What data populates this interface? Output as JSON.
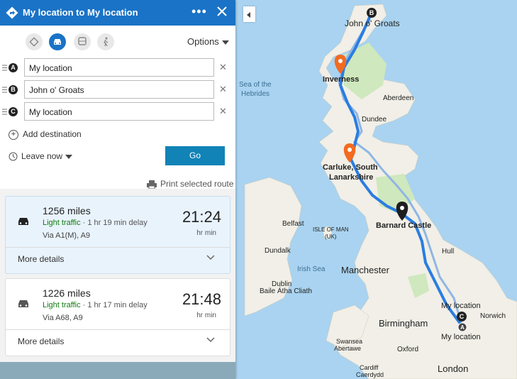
{
  "header": {
    "title": "My location to My location",
    "more_label": "•••"
  },
  "modes": [
    {
      "name": "directions-mode",
      "active": false
    },
    {
      "name": "driving-mode",
      "active": true
    },
    {
      "name": "transit-mode",
      "active": false
    },
    {
      "name": "walking-mode",
      "active": false
    }
  ],
  "options_label": "Options",
  "waypoints": [
    {
      "badge": "A",
      "value": "My location"
    },
    {
      "badge": "B",
      "value": "John o' Groats"
    },
    {
      "badge": "C",
      "value": "My location"
    }
  ],
  "add_destination": "Add destination",
  "leave_now": "Leave now",
  "go_label": "Go",
  "print_label": "Print selected route",
  "routes": [
    {
      "distance": "1256 miles",
      "traffic": "Light traffic",
      "delay": " · 1 hr 19 min delay",
      "via": "Via A1(M), A9",
      "time": "21:24",
      "unit": "hr min",
      "more": "More details"
    },
    {
      "distance": "1226 miles",
      "traffic": "Light traffic",
      "delay": " · 1 hr 17 min delay",
      "via": "Via A68, A9",
      "time": "21:48",
      "unit": "hr min",
      "more": "More details"
    }
  ],
  "map": {
    "labels": {
      "john_o_groats": "John o' Groats",
      "inverness": "Inverness",
      "aberdeen": "Aberdeen",
      "dundee": "Dundee",
      "sea_of_hebrides_1": "Sea of the",
      "sea_of_hebrides_2": "Hebrides",
      "carluke_1": "Carluke, South",
      "carluke_2": "Lanarkshire",
      "barnard_castle": "Barnard Castle",
      "belfast": "Belfast",
      "isle_of_man_1": "ISLE OF MAN",
      "isle_of_man_2": "(UK)",
      "dundalk": "Dundalk",
      "irish_sea": "Irish Sea",
      "manchester": "Manchester",
      "hull": "Hull",
      "dublin_1": "Dublin",
      "dublin_2": "Baile Átha Cliath",
      "my_location_top": "My location",
      "my_location_bottom": "My location",
      "norwich": "Norwich",
      "birmingham": "Birmingham",
      "swansea_1": "Swansea",
      "swansea_2": "Abertawe",
      "oxford": "Oxford",
      "cardiff_1": "Cardiff",
      "cardiff_2": "Caerdydd",
      "london": "London"
    },
    "pins": {
      "a": "A",
      "b": "B",
      "c": "C"
    },
    "colors": {
      "water": "#a9d3f0",
      "land": "#f1efe7",
      "green": "#cfe8bd",
      "route": "#2a7de1",
      "route_alt": "#8fb6e4",
      "pin_orange": "#f26b21",
      "pin_black": "#1e1e1e"
    }
  }
}
